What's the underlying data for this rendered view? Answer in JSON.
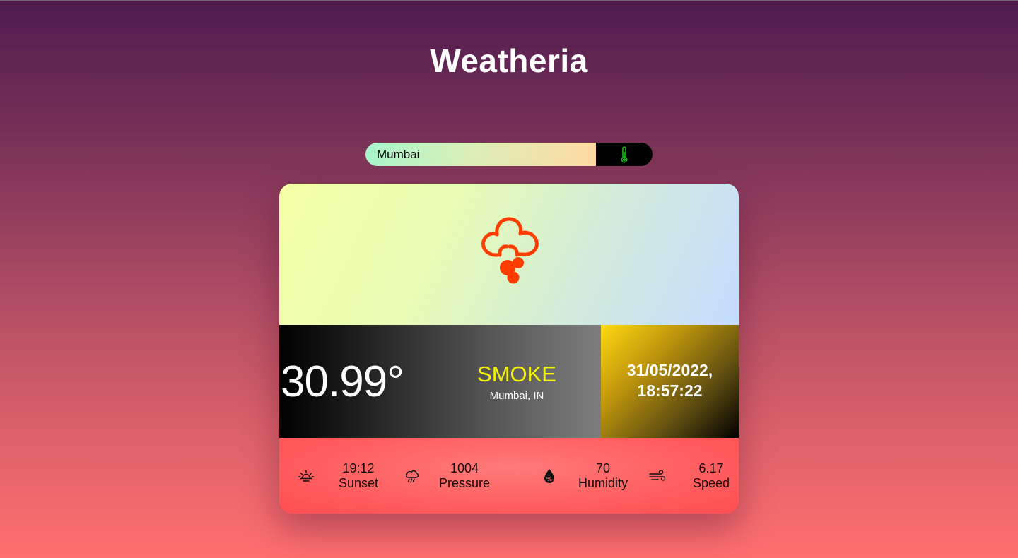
{
  "app": {
    "title": "Weatheria"
  },
  "search": {
    "value": "Mumbai",
    "button_icon": "thermometer-icon"
  },
  "current": {
    "icon": "smoke-icon",
    "temperature": "30.99°",
    "condition": "SMOKE",
    "location": "Mumbai, IN",
    "date": "31/05/2022,",
    "time": "18:57:22"
  },
  "stats": [
    {
      "icon": "sunset-icon",
      "value": "19:12",
      "label": "Sunset"
    },
    {
      "icon": "rain-cloud-icon",
      "value": "1004",
      "label": "Pressure"
    },
    {
      "icon": "humidity-drop-icon",
      "value": "70",
      "label": "Humidity"
    },
    {
      "icon": "wind-icon",
      "value": "6.17",
      "label": "Speed"
    }
  ],
  "colors": {
    "accent_icon": "#ff3d00",
    "condition_text": "#f5f500",
    "thermometer": "#19b319"
  }
}
